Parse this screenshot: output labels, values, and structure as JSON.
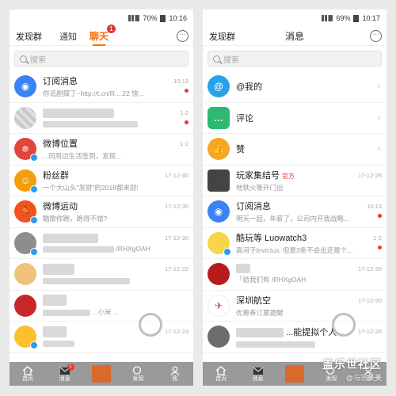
{
  "left": {
    "status": {
      "battery": "70%",
      "time": "10:16"
    },
    "nav": {
      "left": "发现群",
      "tabs": [
        {
          "label": "通知"
        },
        {
          "label": "聊天",
          "badge": "1"
        }
      ]
    },
    "search_placeholder": "搜索",
    "chats": [
      {
        "name": "订阅消息",
        "preview": "你追剧撑了~http://t.cn/R....22 快...",
        "time": "10:13",
        "avatar_color": "#3b82f6",
        "unread": true
      },
      {
        "name": "",
        "preview": "",
        "time": "1-2",
        "avatar_color": "#c0392b",
        "unread": true,
        "blurred": true
      },
      {
        "name": "微博位置",
        "preview": "...同周边生活签到，发现...",
        "time": "1-2",
        "avatar_color": "#e0463b",
        "unread": false
      },
      {
        "name": "粉丝群",
        "preview": "一个大山头\"发财\"的2018都来财!",
        "time": "17-12-30",
        "avatar_color": "#f59e0b",
        "unread": false
      },
      {
        "name": "微博运动",
        "preview": "酷歌你跑，跑得不错?",
        "time": "17-12-30",
        "avatar_color": "#f4511e",
        "unread": false
      },
      {
        "name": "",
        "preview": "/RHXgOAH",
        "time": "17-12-30",
        "avatar_color": "#8d8d8d",
        "unread": false,
        "blurred": true
      },
      {
        "name": "",
        "preview": "",
        "time": "17-12-22",
        "avatar_color": "#f0c27b",
        "unread": false,
        "blurred": true
      },
      {
        "name": "",
        "preview": "...小米 ...",
        "time": "",
        "avatar_color": "#c62828",
        "unread": false,
        "blurred": true
      },
      {
        "name": "",
        "preview": "",
        "time": "17-12-23",
        "avatar_color": "#fbc02d",
        "unread": false,
        "blurred": true
      }
    ],
    "tabbar": [
      {
        "label": "首页"
      },
      {
        "label": "消息",
        "badge": "1"
      },
      {
        "label": ""
      },
      {
        "label": "发现"
      },
      {
        "label": "我"
      }
    ]
  },
  "right": {
    "status": {
      "battery": "69%",
      "time": "10:17"
    },
    "nav": {
      "left": "发现群",
      "title": "消息"
    },
    "search_placeholder": "搜索",
    "items": [
      {
        "name": "@我的",
        "preview": "",
        "time": "",
        "avatar_color": "#29a3e8",
        "chevron": true
      },
      {
        "name": "评论",
        "preview": "",
        "time": "",
        "avatar_color": "#2eb872",
        "chevron": true
      },
      {
        "name": "赞",
        "preview": "",
        "time": "",
        "avatar_color": "#f5a623",
        "chevron": true
      },
      {
        "name": "玩家集结号",
        "tag": "官方",
        "preview": "地铁火等开门出",
        "time": "17-12-28",
        "avatar_color": "#444444"
      },
      {
        "name": "订阅消息",
        "preview": "明天一起，年薪了，公司内开我战略...",
        "time": "10:13",
        "avatar_color": "#3b82f6",
        "unread": true
      },
      {
        "name": "酷玩等 Luowatch3",
        "preview": "高河子Invictus: 但是3条不会出还是个...",
        "time": "1-2",
        "avatar_color": "#f7d44c",
        "unread": true
      },
      {
        "name": "",
        "preview": "「给我们有 /RHXgOAH",
        "time": "17-12-30",
        "avatar_color": "#b71c1c",
        "blurred": true
      },
      {
        "name": "深圳航空",
        "preview": "优惠券订票提醒",
        "time": "17-12-30",
        "avatar_color": "#e53935"
      },
      {
        "name": "",
        "preview": "...能提拟个人...",
        "time": "17-12-26",
        "avatar_color": "#6d6d6d",
        "blurred": true
      }
    ],
    "tabbar": [
      {
        "label": "首页"
      },
      {
        "label": "消息"
      },
      {
        "label": ""
      },
      {
        "label": "发现"
      },
      {
        "label": "我"
      }
    ]
  },
  "watermark": {
    "line1": "盖乐世社区",
    "line2": "@与宗美美"
  },
  "colors": {
    "accent": "#ff6a00",
    "unread": "#e53935",
    "tabbar": "#9a9a9a"
  }
}
